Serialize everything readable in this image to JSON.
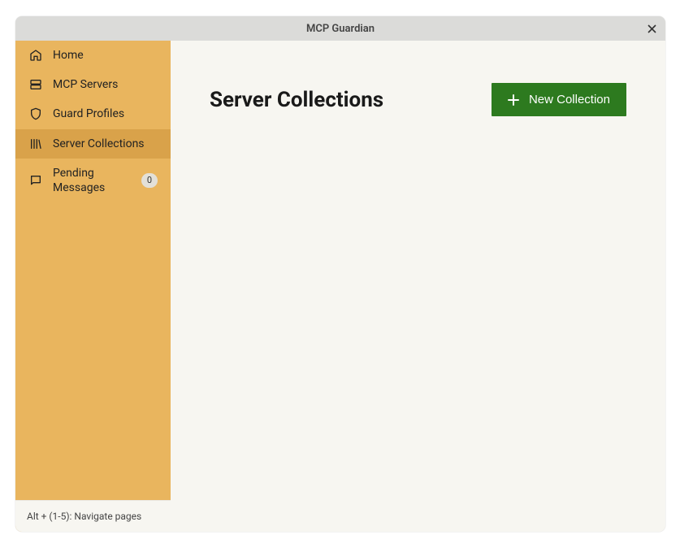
{
  "window": {
    "title": "MCP Guardian"
  },
  "sidebar": {
    "items": [
      {
        "label": "Home"
      },
      {
        "label": "MCP Servers"
      },
      {
        "label": "Guard Profiles"
      },
      {
        "label": "Server Collections"
      },
      {
        "label": "Pending Messages",
        "badge": "0"
      }
    ],
    "footer": "Alt + (1-5): Navigate pages"
  },
  "main": {
    "title": "Server Collections",
    "new_button": "New Collection"
  }
}
